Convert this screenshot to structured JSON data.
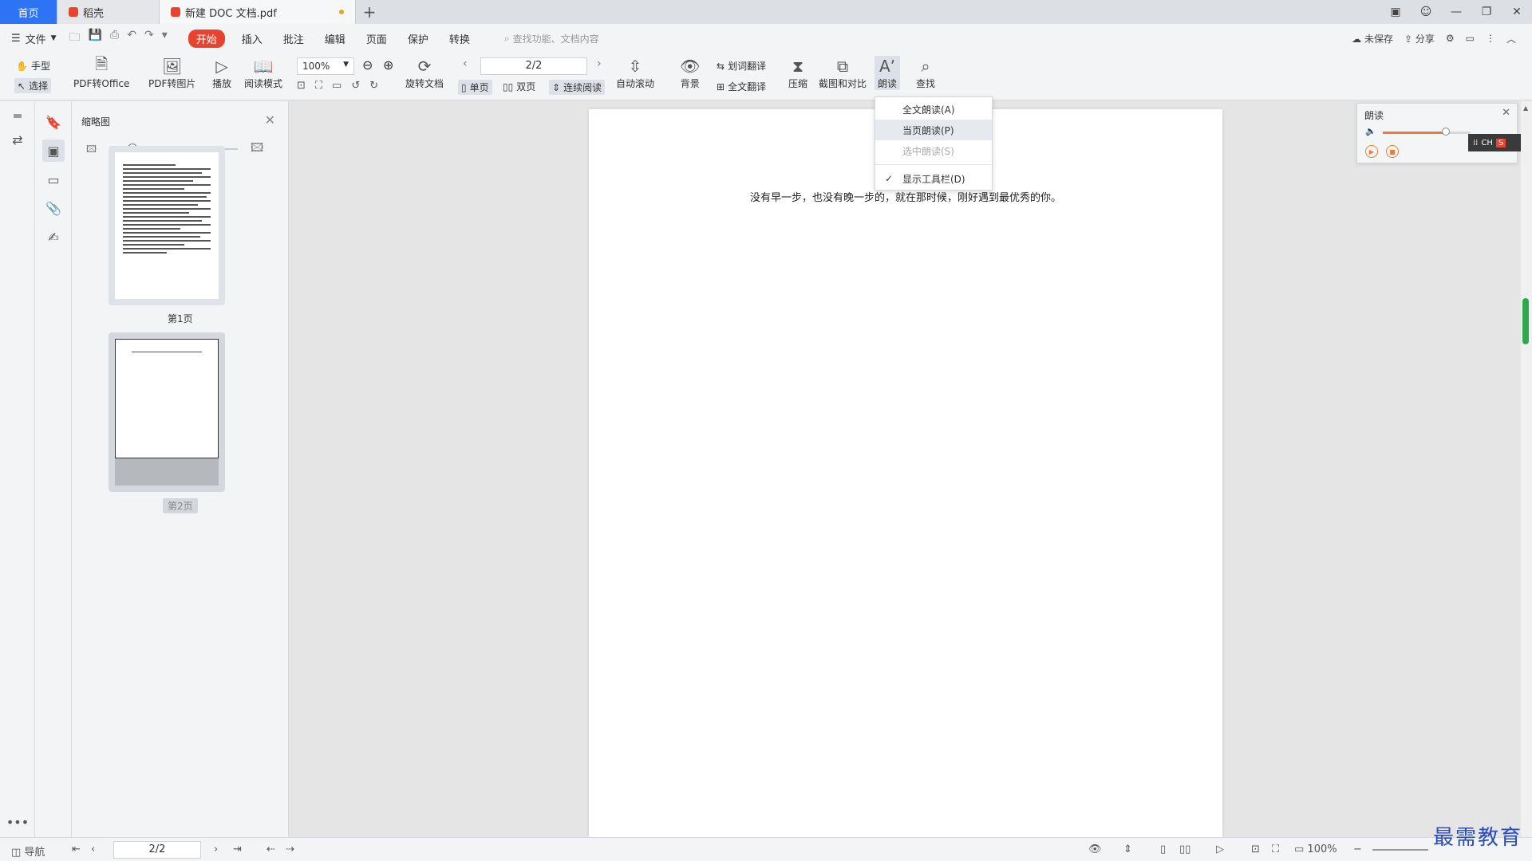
{
  "tabs": {
    "home": "首页",
    "daoke": "稻壳",
    "doc": "新建 DOC 文档.pdf",
    "add": "+"
  },
  "menu": {
    "file": "文件",
    "items": [
      "开始",
      "插入",
      "批注",
      "编辑",
      "页面",
      "保护",
      "转换"
    ],
    "search_placeholder": "查找功能、文档内容",
    "unsaved": "未保存",
    "share": "分享"
  },
  "toolbar": {
    "hand": "手型",
    "select": "选择",
    "pdf_to_office": "PDF转Office",
    "pdf_to_image": "PDF转图片",
    "play": "播放",
    "read_mode": "阅读模式",
    "zoom": "100%",
    "rotate": "旋转文档",
    "page_value": "2/2",
    "single": "单页",
    "double": "双页",
    "continuous": "连续阅读",
    "auto_scroll": "自动滚动",
    "background": "背景",
    "word_translate": "划词翻译",
    "full_translate": "全文翻译",
    "compress": "压缩",
    "screenshot_compare": "截图和对比",
    "read_aloud": "朗读",
    "find": "查找"
  },
  "dropdown": {
    "items": [
      {
        "label": "全文朗读(A)",
        "state": "normal"
      },
      {
        "label": "当页朗读(P)",
        "state": "hover"
      },
      {
        "label": "选中朗读(S)",
        "state": "disabled"
      },
      {
        "label": "显示工具栏(D)",
        "state": "checked"
      }
    ]
  },
  "thumbnails": {
    "title": "缩略图",
    "page1_label": "第1页",
    "page2_label": "第2页"
  },
  "document": {
    "text": "没有早一步，也没有晚一步的，就在那时候，刚好遇到最优秀的你。"
  },
  "read_panel": {
    "title": "朗读",
    "volume": 0.72,
    "ime": "CH"
  },
  "status": {
    "nav": "导航",
    "page_value": "2/2",
    "zoom": "100%"
  },
  "watermark": "最需教育",
  "colors": {
    "accent_blue": "#2d73f5",
    "start_red": "#e8432e",
    "scroll_green": "#2fa84f",
    "volume_orange": "#f07a34"
  }
}
